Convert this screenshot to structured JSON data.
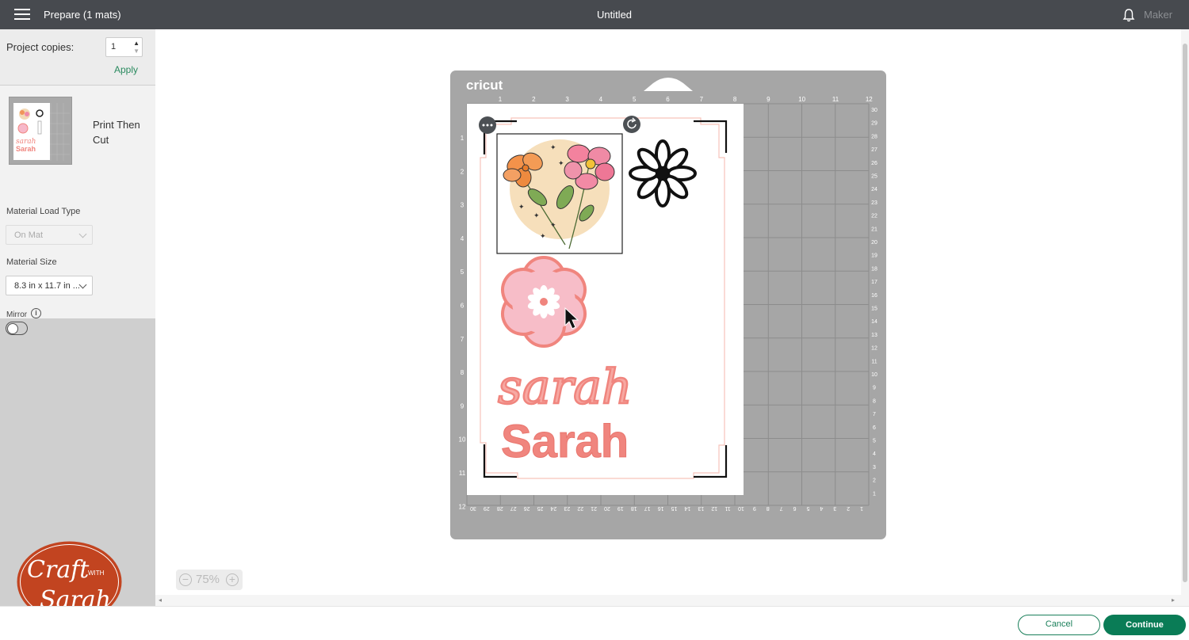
{
  "header": {
    "title_left": "Prepare (1 mats)",
    "title_center": "Untitled",
    "machine": "Maker"
  },
  "left_panel": {
    "project_copies_label": "Project copies:",
    "project_copies_value": "1",
    "apply_label": "Apply",
    "mat_label": "Print Then Cut",
    "material_load_type_label": "Material Load Type",
    "material_load_type_value": "On Mat",
    "material_size_label": "Material Size",
    "material_size_value": "8.3 in x 11.7 in ...",
    "mirror_label": "Mirror"
  },
  "mat": {
    "brand": "cricut",
    "top_ruler": [
      "1",
      "2",
      "3",
      "4",
      "5",
      "6",
      "7",
      "8",
      "9",
      "10",
      "11",
      "12"
    ],
    "left_ruler": [
      "1",
      "2",
      "3",
      "4",
      "5",
      "6",
      "7",
      "8",
      "9",
      "10",
      "11",
      "12"
    ],
    "right_ruler": [
      "30",
      "29",
      "28",
      "27",
      "26",
      "25",
      "24",
      "23",
      "22",
      "21",
      "20",
      "19",
      "18",
      "17",
      "16",
      "15",
      "14",
      "13",
      "12",
      "11",
      "10",
      "9",
      "8",
      "7",
      "6",
      "5",
      "4",
      "3",
      "2",
      "1"
    ],
    "bottom_ruler": [
      "30",
      "29",
      "28",
      "27",
      "26",
      "25",
      "24",
      "23",
      "22",
      "21",
      "20",
      "19",
      "18",
      "17",
      "16",
      "15",
      "14",
      "13",
      "12",
      "11",
      "10",
      "9",
      "8",
      "7",
      "6",
      "5",
      "4",
      "3",
      "2",
      "1"
    ],
    "text_script": "sarah",
    "text_bold": "Sarah"
  },
  "zoom": {
    "level": "75%"
  },
  "footer": {
    "cancel_label": "Cancel",
    "continue_label": "Continue"
  },
  "watermark": {
    "line1": "Craft",
    "line2": "WITH",
    "line3": "Sarah"
  },
  "colors": {
    "accent": "#0a7c56",
    "topbar": "#474a4f",
    "mat": "#a6a6a6",
    "pink": "#f0857e"
  }
}
